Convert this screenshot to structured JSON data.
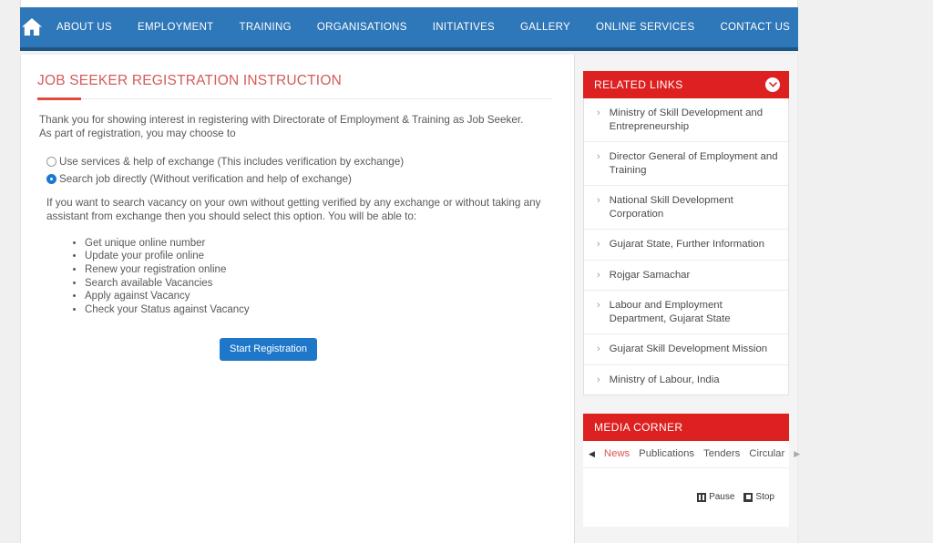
{
  "navbar": {
    "home_icon": "home-icon",
    "items": [
      {
        "label": "ABOUT US"
      },
      {
        "label": "EMPLOYMENT"
      },
      {
        "label": "TRAINING"
      },
      {
        "label": "ORGANISATIONS"
      },
      {
        "label": "INITIATIVES"
      },
      {
        "label": "GALLERY"
      },
      {
        "label": "ONLINE SERVICES"
      },
      {
        "label": "CONTACT US"
      }
    ],
    "bg_color": "#2e77b8",
    "border_color": "#1d5585"
  },
  "main": {
    "title": "JOB SEEKER REGISTRATION INSTRUCTION",
    "title_color": "#d45b5b",
    "accent_color": "#e04a3f",
    "intro_line1": "Thank you for showing interest in registering with Directorate of Employment & Training as Job Seeker.",
    "intro_line2": "As part of registration, you may choose to",
    "options": [
      {
        "label": "Use services & help of exchange (This includes verification by exchange)",
        "selected": false
      },
      {
        "label": "Search job directly (Without verification and help of exchange)",
        "selected": true
      }
    ],
    "explanation": "If you want to search vacancy on your own without getting verified by any exchange or without taking any assistant from exchange then you should select this option. You will be able to:",
    "benefits": [
      "Get unique online number",
      "Update your profile online",
      "Renew your registration online",
      "Search available Vacancies",
      "Apply against Vacancy",
      "Check your Status against Vacancy"
    ],
    "start_button": "Start Registration",
    "button_color": "#1f77c9"
  },
  "sidebar": {
    "related_links": {
      "heading": "RELATED LINKS",
      "heading_bg": "#dd2020",
      "collapse_icon": "chevron-down-icon",
      "items": [
        {
          "label": "Ministry of Skill Development and Entrepreneurship"
        },
        {
          "label": "Director General of Employment and Training"
        },
        {
          "label": "National Skill Development Corporation"
        },
        {
          "label": "Gujarat State, Further Information"
        },
        {
          "label": "Rojgar Samachar"
        },
        {
          "label": "Labour and Employment Department, Gujarat State"
        },
        {
          "label": "Gujarat Skill Development Mission"
        },
        {
          "label": "Ministry of Labour, India"
        }
      ]
    },
    "media_corner": {
      "heading": "MEDIA CORNER",
      "prev_icon": "arrow-left-icon",
      "next_icon": "arrow-right-icon",
      "tabs": [
        {
          "label": "News",
          "active": true
        },
        {
          "label": "Publications",
          "active": false
        },
        {
          "label": "Tenders",
          "active": false
        },
        {
          "label": "Circular",
          "active": false
        }
      ],
      "active_color": "#d9534f",
      "controls": [
        {
          "label": "Pause",
          "icon": "pause-icon"
        },
        {
          "label": "Stop",
          "icon": "stop-icon"
        }
      ]
    }
  }
}
